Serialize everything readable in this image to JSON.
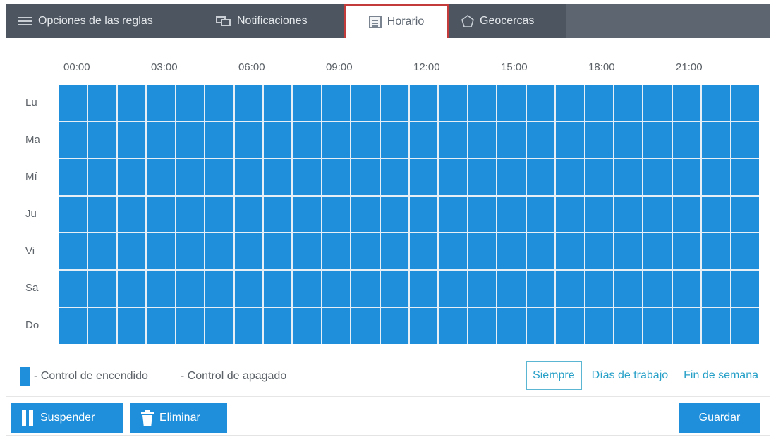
{
  "tabs": [
    {
      "label": "Opciones de las reglas",
      "icon": "menu-icon"
    },
    {
      "label": "Notificaciones",
      "icon": "notifications-icon"
    },
    {
      "label": "Horario",
      "icon": "calendar-icon",
      "active": true
    },
    {
      "label": "Geocercas",
      "icon": "geofence-icon"
    }
  ],
  "schedule": {
    "hours": [
      "00:00",
      "03:00",
      "06:00",
      "09:00",
      "12:00",
      "15:00",
      "18:00",
      "21:00"
    ],
    "days": [
      "Lu",
      "Ma",
      "Mí",
      "Ju",
      "Vi",
      "Sa",
      "Do"
    ],
    "slots_per_day": 24,
    "all_on": true
  },
  "legend": {
    "on_label": "- Control de encendido",
    "off_label": "- Control de apagado"
  },
  "presets": {
    "always": "Siempre",
    "workdays": "Días de trabajo",
    "weekend": "Fin de semana"
  },
  "buttons": {
    "suspend": "Suspender",
    "delete": "Eliminar",
    "save": "Guardar"
  },
  "colors": {
    "on": "#1f8fdb",
    "tabbar": "#4d5561",
    "active_border": "#c43b3b",
    "link": "#27a0c8"
  }
}
